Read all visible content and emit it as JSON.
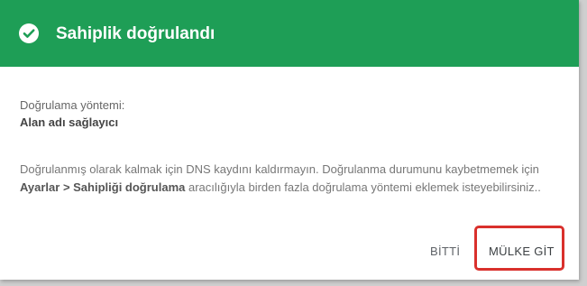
{
  "dialog": {
    "title": "Sahiplik doğrulandı",
    "header_color": "#1e9e56",
    "method_label": "Doğrulama yöntemi:",
    "method_value": "Alan adı sağlayıcı",
    "description": {
      "part1": "Doğrulanmış olarak kalmak için DNS kaydını kaldırmayın. Doğrulanma durumunu kaybetmemek için ",
      "bold": "Ayarlar > Sahipliği doğrulama",
      "part2": " aracılığıyla birden fazla doğrulama yöntemi eklemek isteyebilirsiniz.."
    },
    "buttons": {
      "done_label": "BİTTİ",
      "go_label": "MÜLKE GİT"
    },
    "highlight_color": "#d9302c"
  }
}
